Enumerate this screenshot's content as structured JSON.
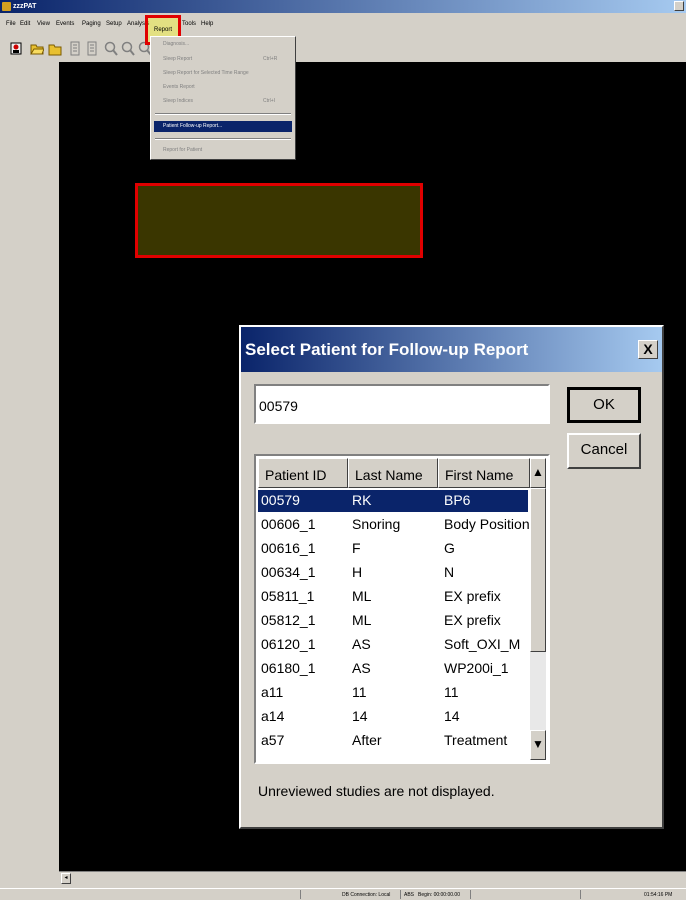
{
  "window": {
    "title": "zzzPAT"
  },
  "menubar": {
    "items": [
      {
        "label": "File"
      },
      {
        "label": "Edit"
      },
      {
        "label": "View"
      },
      {
        "label": "Events"
      },
      {
        "label": "Paging"
      },
      {
        "label": "Setup"
      },
      {
        "label": "Analysis"
      },
      {
        "label": "Report"
      },
      {
        "label": "Tools"
      },
      {
        "label": "Help"
      }
    ]
  },
  "toolbar": {
    "icons": [
      "patient-icon",
      "open-folder-icon",
      "folder-icon",
      "document-icon",
      "document2-icon",
      "zoom-in-icon",
      "zoom-out-icon",
      "zoom-icon"
    ]
  },
  "report_menu": {
    "items": [
      {
        "label": "Diagnosis...",
        "shortcut": "",
        "enabled": false
      },
      {
        "label": "Sleep Report",
        "shortcut": "Ctrl+R",
        "enabled": false
      },
      {
        "label": "Sleep Report for Selected Time Range",
        "shortcut": "",
        "enabled": false
      },
      {
        "label": "Events Report",
        "shortcut": "",
        "enabled": false
      },
      {
        "label": "Sleep Indices",
        "shortcut": "Ctrl+I",
        "enabled": false
      },
      {
        "label": "Patient Follow-up Report...",
        "shortcut": "",
        "enabled": true,
        "highlighted": true
      },
      {
        "label": "Report for Patient",
        "shortcut": "",
        "enabled": false
      }
    ]
  },
  "dialog": {
    "title": "Select Patient for Follow-up Report",
    "close_label": "X",
    "search_value": "00579",
    "ok_label": "OK",
    "cancel_label": "Cancel",
    "columns": [
      "Patient ID",
      "Last Name",
      "First Name"
    ],
    "rows": [
      [
        "00579",
        "RK",
        "BP6"
      ],
      [
        "00606_1",
        "Snoring",
        "Body Position"
      ],
      [
        "00616_1",
        "F",
        "G"
      ],
      [
        "00634_1",
        "H",
        "N"
      ],
      [
        "05811_1",
        "ML",
        "EX prefix"
      ],
      [
        "05812_1",
        "ML",
        "EX prefix"
      ],
      [
        "06120_1",
        "AS",
        "Soft_OXI_M"
      ],
      [
        "06180_1",
        "AS",
        "WP200i_1"
      ],
      [
        "a11",
        "11",
        "11"
      ],
      [
        "a14",
        "14",
        "14"
      ],
      [
        "a57",
        "After",
        "Treatment"
      ]
    ],
    "selected_index": 0,
    "note": "Unreviewed studies are not displayed."
  },
  "statusbar": {
    "db": "DB Connection: Local",
    "mode": "ABS",
    "begin": "Begin: 00:00:00.00",
    "time": "01:54:16 PM"
  },
  "colors": {
    "selection": "#0a246a",
    "highlight_border": "#e00000",
    "canvas": "#000000",
    "olive_box": "#3a3600"
  }
}
